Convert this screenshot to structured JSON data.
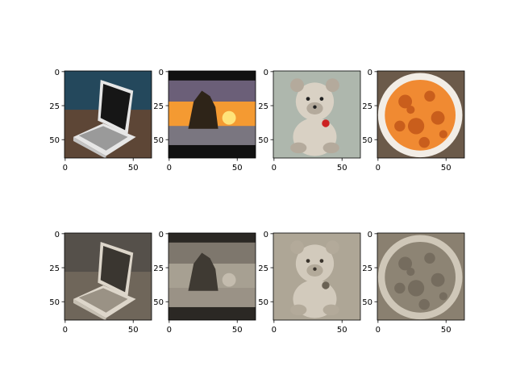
{
  "figure": {
    "background": "#ffffff",
    "axis_color": "#000000",
    "grid": false,
    "layout": "2 rows x 4 columns of image thumbnails",
    "x_ticks": [
      "0",
      "50"
    ],
    "y_ticks": [
      "0",
      "25",
      "50"
    ],
    "image_extent": [
      64,
      64
    ],
    "panels": [
      {
        "row": "original",
        "subject": "laptop",
        "palette": {
          "sky": "#24485c",
          "floor": "#5d4636",
          "body": "#c4c4c4",
          "screen": "#161616",
          "keys": "#9a9a9a",
          "bezel": "#e6e6e6"
        }
      },
      {
        "row": "original",
        "subject": "sunset rock",
        "palette": {
          "top": "#111111",
          "sky_top": "#6b5f78",
          "sky_glow": "#f49a32",
          "sun": "#ffe37a",
          "rock": "#2e2418",
          "water": "#7a7680",
          "bottom": "#111111"
        }
      },
      {
        "row": "original",
        "subject": "teddy bear",
        "palette": {
          "bg": "#aeb7ad",
          "fur": "#d9d1c4",
          "shade": "#b4aa9c",
          "eye": "#222222",
          "heart": "#cc2222"
        }
      },
      {
        "row": "original",
        "subject": "chips plate",
        "palette": {
          "bg": "#6b5a4a",
          "plate": "#f2ede6",
          "chips": "#f08a32",
          "chips_dark": "#c95e1c"
        }
      },
      {
        "row": "sepia",
        "subject": "laptop",
        "palette": {
          "sky": "#55504a",
          "floor": "#6f665a",
          "body": "#c6bfb2",
          "screen": "#3a3630",
          "keys": "#9a9285",
          "bezel": "#ddd6ca"
        }
      },
      {
        "row": "sepia",
        "subject": "sunset rock",
        "palette": {
          "top": "#2b2824",
          "sky_top": "#7e776d",
          "sky_glow": "#a7a092",
          "sun": "#c4bcae",
          "rock": "#3f3a33",
          "water": "#9a9286",
          "bottom": "#2b2824"
        }
      },
      {
        "row": "sepia",
        "subject": "teddy bear",
        "palette": {
          "bg": "#aea696",
          "fur": "#d2cabc",
          "shade": "#b3aa9a",
          "eye": "#3a342c",
          "heart": "#6a6254"
        }
      },
      {
        "row": "sepia",
        "subject": "chips plate",
        "palette": {
          "bg": "#8a8070",
          "plate": "#cfc7b8",
          "chips": "#8d8474",
          "chips_dark": "#756c5e"
        }
      }
    ]
  }
}
